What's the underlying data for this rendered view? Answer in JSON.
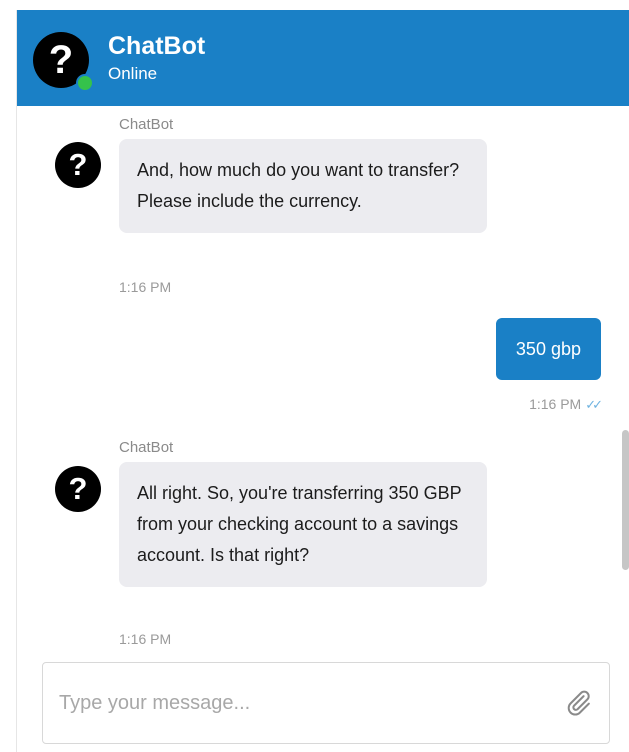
{
  "header": {
    "title": "ChatBot",
    "status": "Online",
    "avatar_glyph": "?",
    "status_color": "#35c24b",
    "accent_color": "#1a80c6"
  },
  "messages": [
    {
      "sender": "ChatBot",
      "avatar_glyph": "?",
      "text": "And, how much do you want to transfer? Please include the currency.",
      "time": "1:16 PM"
    },
    {
      "sender": "user",
      "text": "350 gbp",
      "time": "1:16 PM",
      "read_icon": "double-check-icon"
    },
    {
      "sender": "ChatBot",
      "avatar_glyph": "?",
      "text": "All right. So, you're transferring 350 GBP from your checking account to a savings account. Is that right?",
      "time": "1:16 PM"
    }
  ],
  "composer": {
    "value": "",
    "placeholder": "Type your message...",
    "attach_icon": "paperclip-icon"
  }
}
